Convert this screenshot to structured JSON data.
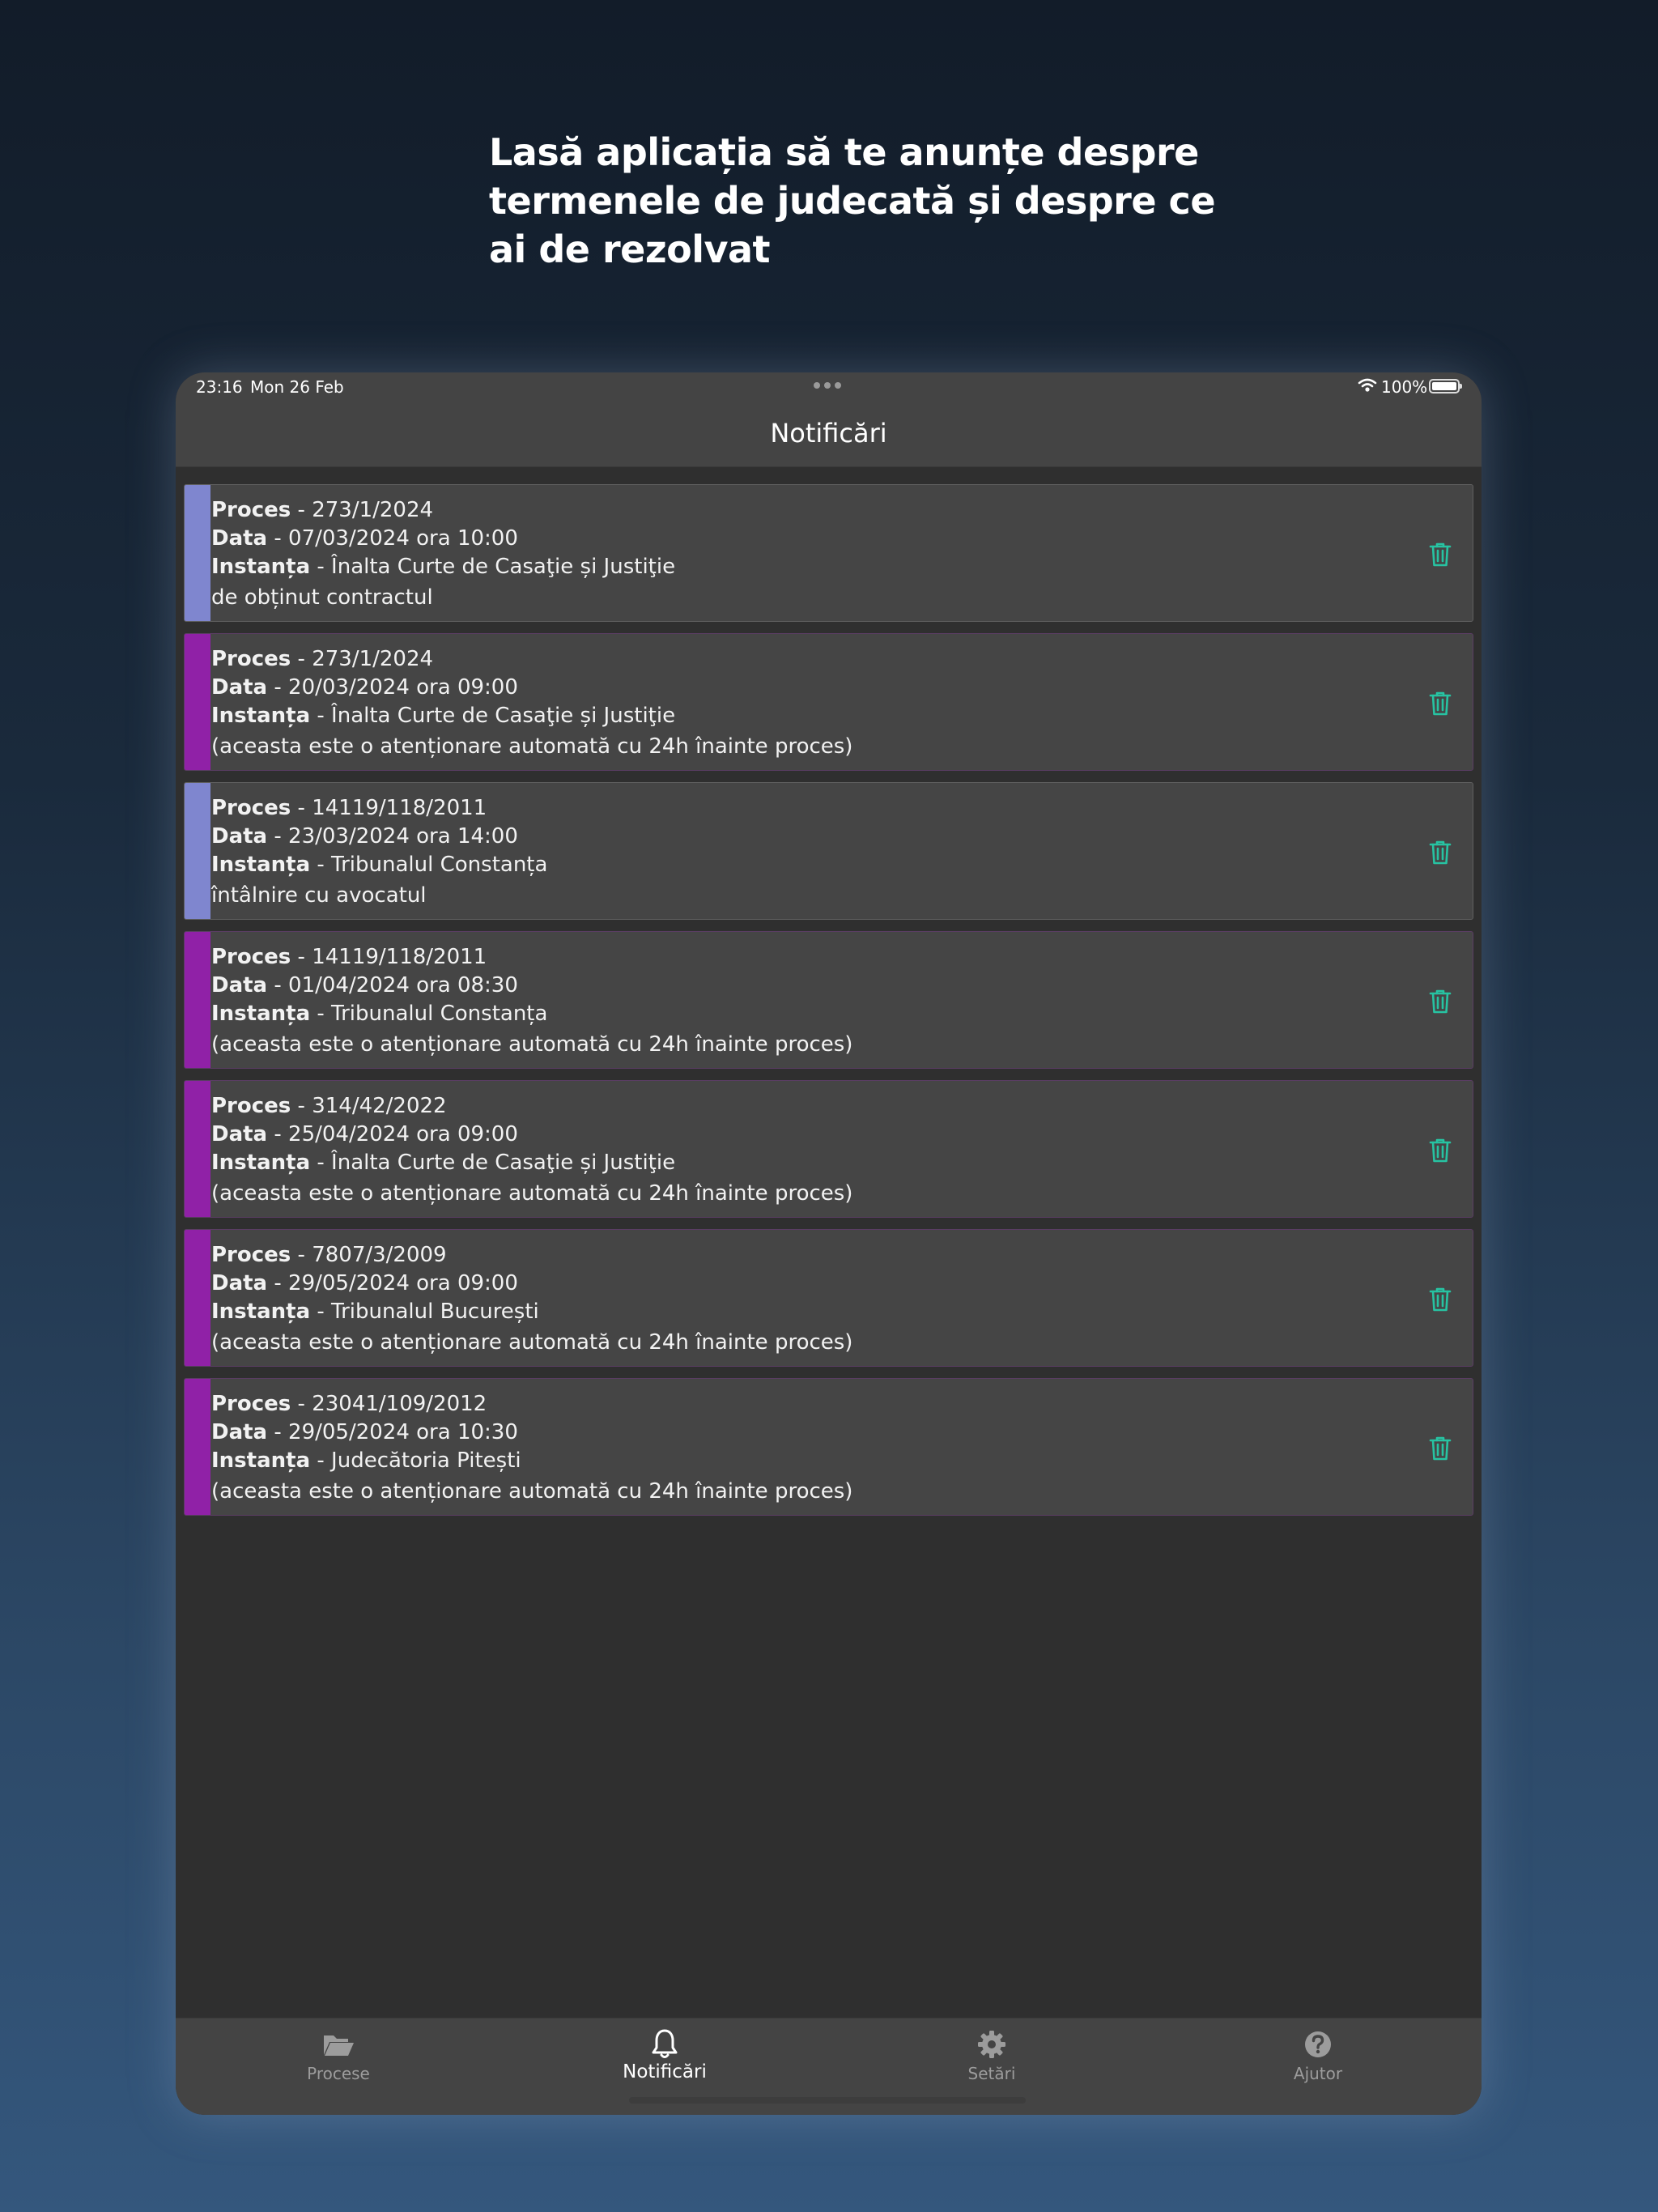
{
  "headline": [
    "Lasă aplicația să te anunțe despre",
    "termenele de judecată și despre ce",
    "ai de rezolvat"
  ],
  "status_bar": {
    "time": "23:16",
    "date": "Mon 26 Feb",
    "battery": "100%"
  },
  "nav": {
    "title": "Notificări"
  },
  "colors": {
    "manual_stripe": "#7f86cf",
    "auto_stripe": "#9021a7",
    "trash_icon": "#27c3a2",
    "card_bg": "#454545"
  },
  "notifications": [
    {
      "kind": "manual",
      "proc_label": "Proces",
      "proc_value": "273/1/2024",
      "data_label": "Data",
      "data_value": "07/03/2024 ora 10:00",
      "inst_label": "Instanța",
      "inst_value": "Înalta Curte de Casaţie și Justiţie",
      "note": "de obținut contractul"
    },
    {
      "kind": "auto",
      "proc_label": "Proces",
      "proc_value": "273/1/2024",
      "data_label": "Data",
      "data_value": "20/03/2024 ora 09:00",
      "inst_label": "Instanța",
      "inst_value": "Înalta Curte de Casaţie și Justiţie",
      "note": "(aceasta este o atenționare automată cu 24h înainte proces)"
    },
    {
      "kind": "manual",
      "proc_label": "Proces",
      "proc_value": "14119/118/2011",
      "data_label": "Data",
      "data_value": "23/03/2024 ora 14:00",
      "inst_label": "Instanța",
      "inst_value": "Tribunalul Constanța",
      "note": "întâlnire cu avocatul"
    },
    {
      "kind": "auto",
      "proc_label": "Proces",
      "proc_value": "14119/118/2011",
      "data_label": "Data",
      "data_value": "01/04/2024 ora 08:30",
      "inst_label": "Instanța",
      "inst_value": "Tribunalul Constanța",
      "note": "(aceasta este o atenționare automată cu 24h înainte proces)"
    },
    {
      "kind": "auto",
      "proc_label": "Proces",
      "proc_value": "314/42/2022",
      "data_label": "Data",
      "data_value": "25/04/2024 ora 09:00",
      "inst_label": "Instanța",
      "inst_value": "Înalta Curte de Casaţie și Justiţie",
      "note": "(aceasta este o atenționare automată cu 24h înainte proces)"
    },
    {
      "kind": "auto",
      "proc_label": "Proces",
      "proc_value": "7807/3/2009",
      "data_label": "Data",
      "data_value": "29/05/2024 ora 09:00",
      "inst_label": "Instanța",
      "inst_value": "Tribunalul București",
      "note": "(aceasta este o atenționare automată cu 24h înainte proces)"
    },
    {
      "kind": "auto",
      "proc_label": "Proces",
      "proc_value": "23041/109/2012",
      "data_label": "Data",
      "data_value": "29/05/2024 ora 10:30",
      "inst_label": "Instanța",
      "inst_value": "Judecătoria Pitești",
      "note": "(aceasta este o atenționare automată cu 24h înainte proces)"
    }
  ],
  "tabs": [
    {
      "label": "Procese",
      "icon": "folder-icon",
      "active": false
    },
    {
      "label": "Notificări",
      "icon": "bell-icon",
      "active": true
    },
    {
      "label": "Setări",
      "icon": "gear-icon",
      "active": false
    },
    {
      "label": "Ajutor",
      "icon": "help-icon",
      "active": false
    }
  ]
}
